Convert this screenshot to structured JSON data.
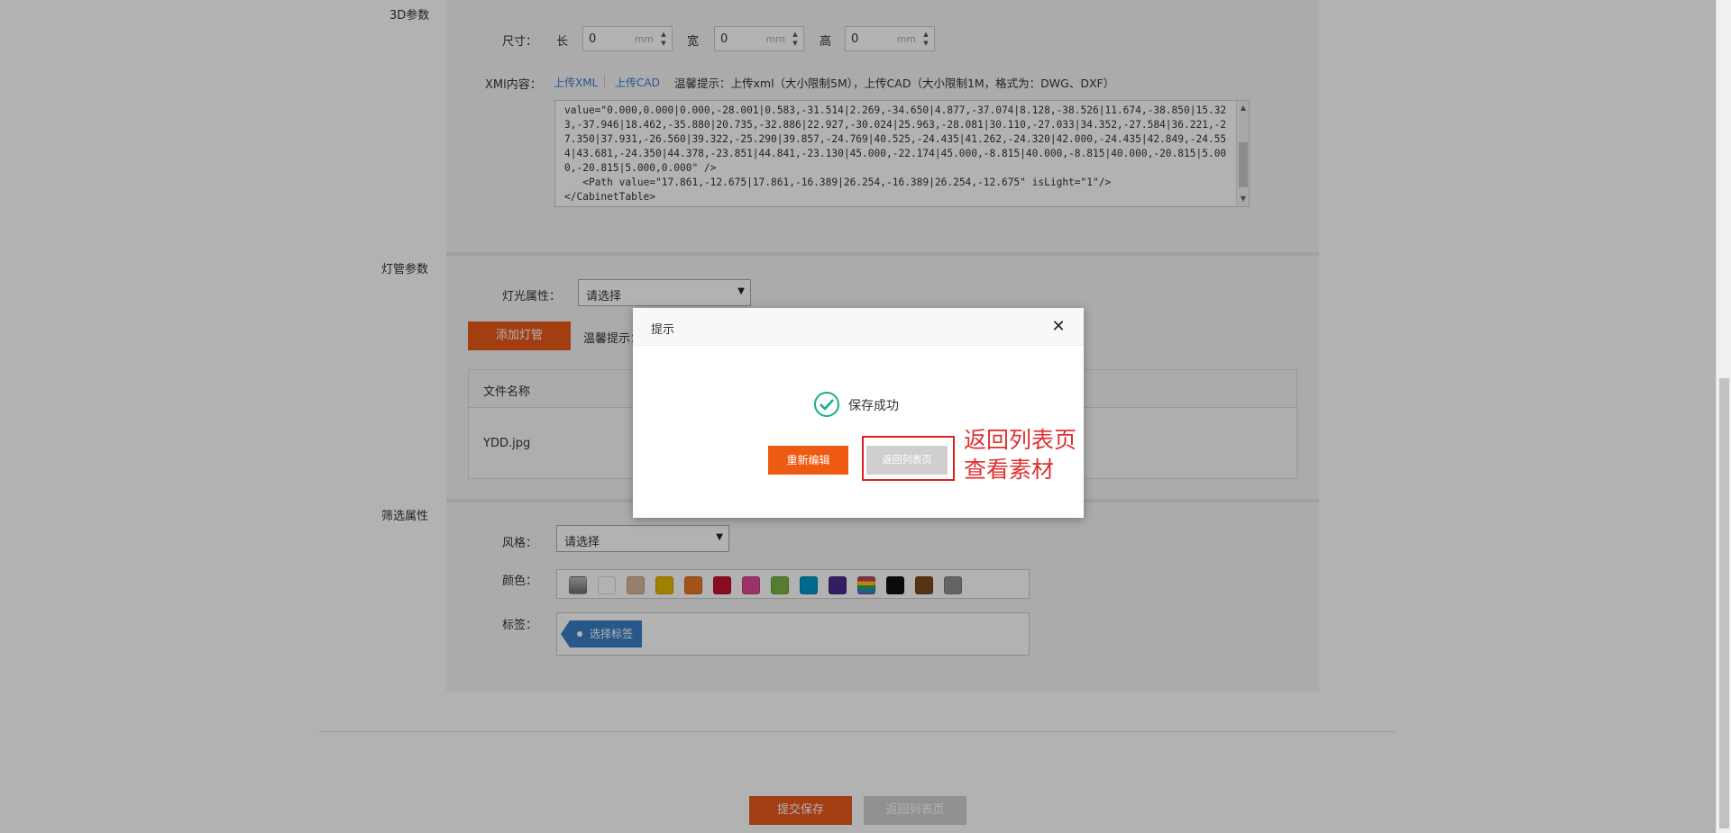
{
  "sections": {
    "params_3d": "3D参数",
    "lamp_params": "灯管参数",
    "filter_attrs": "筛选属性"
  },
  "size": {
    "label": "尺寸：",
    "length_label": "长",
    "width_label": "宽",
    "height_label": "高",
    "length_value": "0",
    "width_value": "0",
    "height_value": "0",
    "unit": "mm"
  },
  "xml": {
    "label": "XMl内容：",
    "upload_xml": "上传XML",
    "upload_cad": "上传CAD",
    "hint": "温馨提示：上传xml（大小限制5M），上传CAD（大小限制1M，格式为：DWG、DXF）",
    "content": "value=\"0.000,0.000|0.000,-28.001|0.583,-31.514|2.269,-34.650|4.877,-37.074|8.128,-38.526|11.674,-38.850|15.323,-37.946|18.462,-35.880|20.735,-32.886|22.927,-30.024|25.963,-28.081|30.110,-27.033|34.352,-27.584|36.221,-27.350|37.931,-26.560|39.322,-25.290|39.857,-24.769|40.525,-24.435|41.262,-24.320|42.000,-24.435|42.849,-24.554|43.681,-24.350|44.378,-23.851|44.841,-23.130|45.000,-22.174|45.000,-8.815|40.000,-8.815|40.000,-20.815|5.000,-20.815|5.000,0.000\" />\n   <Path value=\"17.861,-12.675|17.861,-16.389|26.254,-16.389|26.254,-12.675\" isLight=\"1\"/>\n</CabinetTable>"
  },
  "lamp": {
    "light_attr_label": "灯光属性：",
    "light_attr_value": "请选择",
    "add_lamp_button": "添加灯管",
    "hint": "温馨提示：",
    "table_header": "文件名称",
    "file_name": "YDD.jpg"
  },
  "filter": {
    "style_label": "风格：",
    "style_value": "请选择",
    "color_label": "颜色：",
    "tag_label": "标签：",
    "tag_button": "选择标签",
    "colors": [
      "#8a8a8a",
      "#ffffff",
      "#d9b79c",
      "#e6b800",
      "#e87722",
      "#c8102e",
      "#e04896",
      "#7cb342",
      "#0099cc",
      "#4b2a8a",
      "multi",
      "#111111",
      "#7a4a1c",
      "#909090"
    ]
  },
  "footer": {
    "submit_button": "提交保存",
    "back_button": "返回列表页"
  },
  "modal": {
    "title": "提示",
    "message": "保存成功",
    "edit_button": "重新编辑",
    "back_button": "返回列表页",
    "annotation_line1": "返回列表页",
    "annotation_line2": "查看素材"
  }
}
